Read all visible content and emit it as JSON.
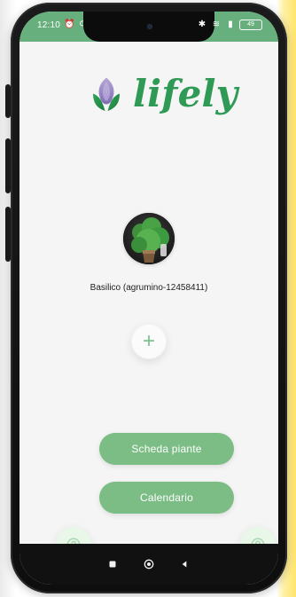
{
  "status_bar": {
    "time": "12:10",
    "battery": "49",
    "icons": [
      "alarm-icon",
      "sync-icon",
      "bluetooth-icon",
      "wifi-icon",
      "signal-icon",
      "battery-icon"
    ]
  },
  "app": {
    "logo_text": "lifely",
    "plant_label": "Basilico (agrumino-12458411)",
    "add_symbol": "+",
    "buttons": {
      "plant_sheet": "Scheda piante",
      "calendar": "Calendario"
    },
    "bottom_icons": {
      "help_icon": "help-icon",
      "profile_icon": "profile-icon"
    }
  },
  "system_nav": {
    "items": [
      "overview-button",
      "home-button",
      "back-button"
    ]
  },
  "colors": {
    "status_green": "#67b07d",
    "brand_green": "#2f9a55",
    "pill_green": "#7bbd84",
    "background": "#f5f5f5"
  }
}
